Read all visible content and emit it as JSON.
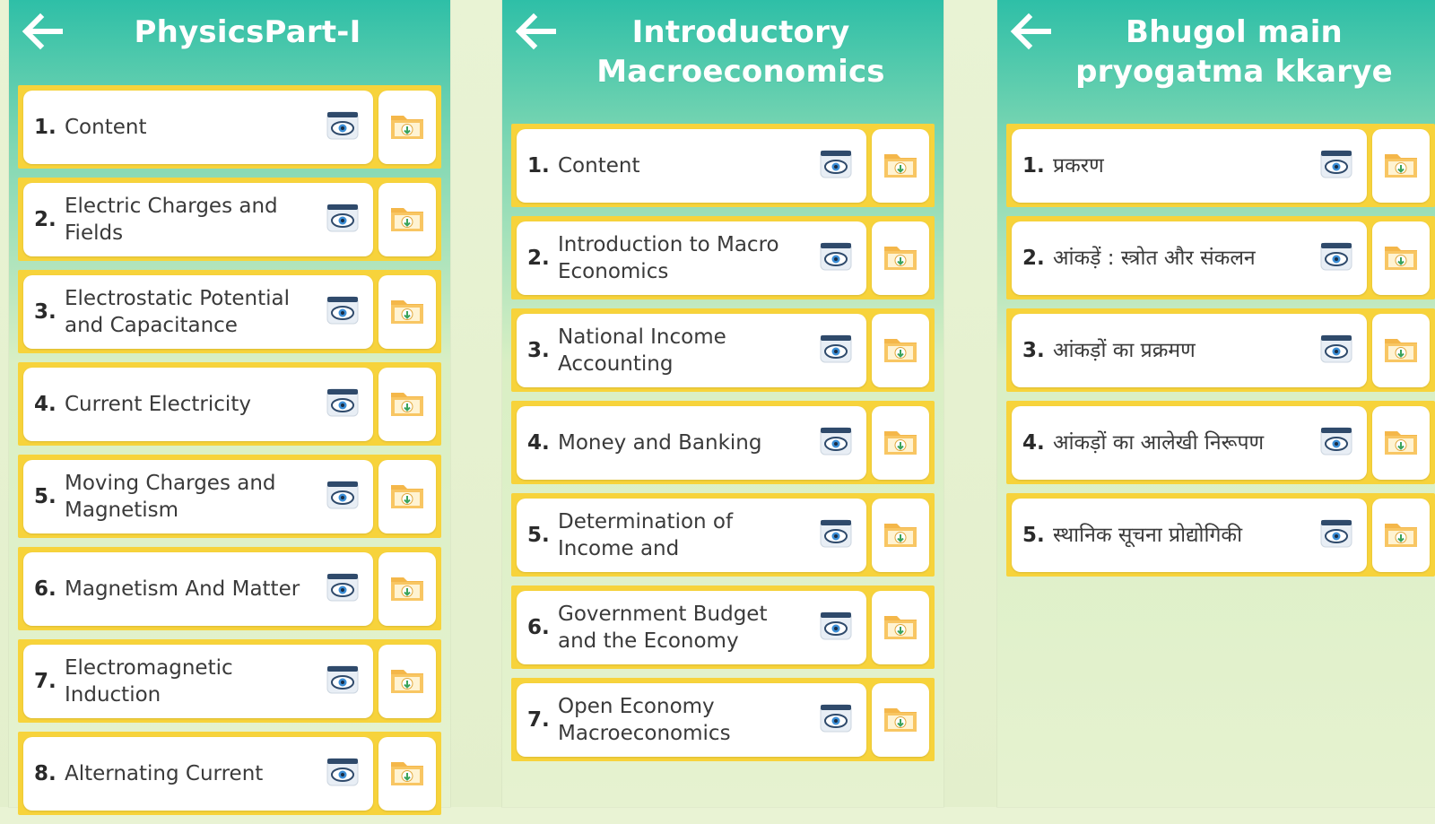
{
  "icons": {
    "back": "back-arrow-icon",
    "view": "eye-icon",
    "download": "download-folder-icon"
  },
  "colors": {
    "header": "#2ebfa7",
    "item_border": "#f7d33b",
    "card": "#ffffff",
    "folder": "#f4b74a"
  },
  "panels": [
    {
      "title": "PhysicsPart-I",
      "items": [
        {
          "num": "1.",
          "label": "Content"
        },
        {
          "num": "2.",
          "label": "Electric Charges and Fields"
        },
        {
          "num": "3.",
          "label": "Electrostatic Potential and Capacitance"
        },
        {
          "num": "4.",
          "label": "Current Electricity"
        },
        {
          "num": "5.",
          "label": "Moving Charges and Magnetism"
        },
        {
          "num": "6.",
          "label": "Magnetism And Matter"
        },
        {
          "num": "7.",
          "label": "Electromagnetic Induction"
        },
        {
          "num": "8.",
          "label": "Alternating Current"
        }
      ]
    },
    {
      "title": "Introductory Macroeconomics",
      "items": [
        {
          "num": "1.",
          "label": "Content"
        },
        {
          "num": "2.",
          "label": "Introduction to Macro Economics"
        },
        {
          "num": "3.",
          "label": "National Income Accounting"
        },
        {
          "num": "4.",
          "label": "Money and Banking"
        },
        {
          "num": "5.",
          "label": "Determination of Income and"
        },
        {
          "num": "6.",
          "label": "Government Budget and the Economy"
        },
        {
          "num": "7.",
          "label": "Open Economy Macroeconomics"
        }
      ]
    },
    {
      "title": "Bhugol main pryogatma kkarye",
      "items": [
        {
          "num": "1.",
          "label": "प्रकरण"
        },
        {
          "num": "2.",
          "label": "आंकड़ें : स्त्रोत और संकलन"
        },
        {
          "num": "3.",
          "label": "आंकड़ों का प्रक्रमण"
        },
        {
          "num": "4.",
          "label": "आंकड़ों का आलेखी निरूपण"
        },
        {
          "num": "5.",
          "label": "स्थानिक सूचना प्रोद्योगिकी"
        }
      ]
    }
  ]
}
